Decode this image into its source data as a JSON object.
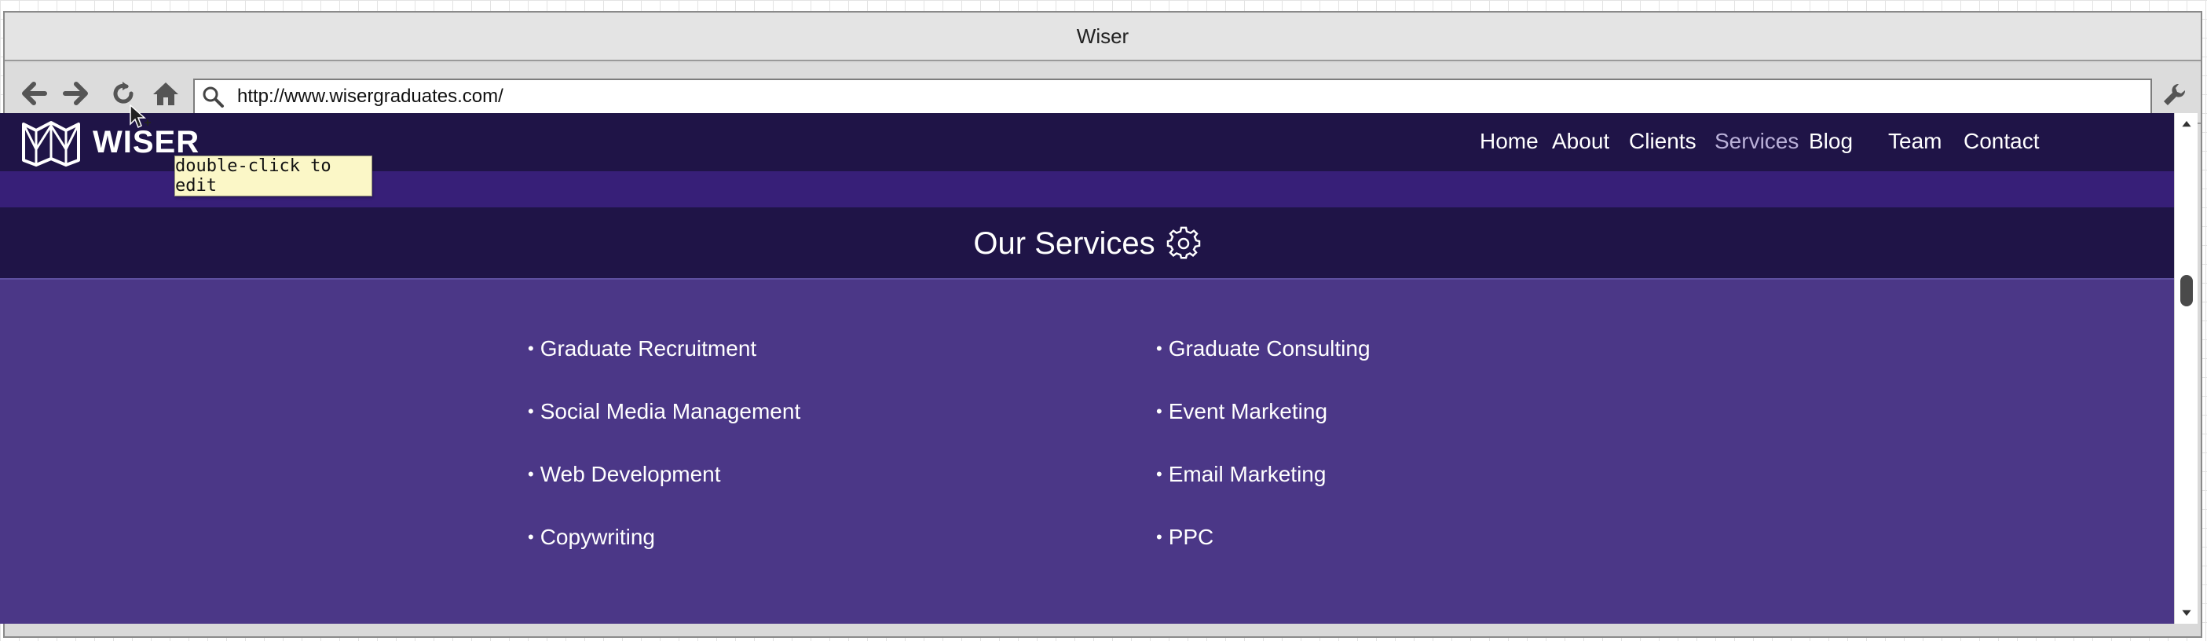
{
  "window": {
    "title": "Wiser"
  },
  "toolbar": {
    "url": "http://www.wisergraduates.com/"
  },
  "site": {
    "logo_text": "WISER",
    "nav": [
      {
        "label": "Home",
        "active": false
      },
      {
        "label": "About",
        "active": false
      },
      {
        "label": "Clients",
        "active": false
      },
      {
        "label": "Services",
        "active": true
      },
      {
        "label": "Blog",
        "active": false
      },
      {
        "label": "Team",
        "active": false
      },
      {
        "label": "Contact",
        "active": false
      }
    ],
    "section_title": "Our Services",
    "services_left": [
      "Graduate Recruitment",
      "Social Media Management",
      "Web Development",
      "Copywriting"
    ],
    "services_right": [
      "Graduate Consulting",
      "Event Marketing",
      "Email Marketing",
      "PPC"
    ]
  },
  "tooltip": "double-click to edit",
  "colors": {
    "header_bg": "#1f1447",
    "band_bg": "#371f78",
    "content_bg": "#4b3787",
    "active_nav": "#b9b0d8"
  }
}
